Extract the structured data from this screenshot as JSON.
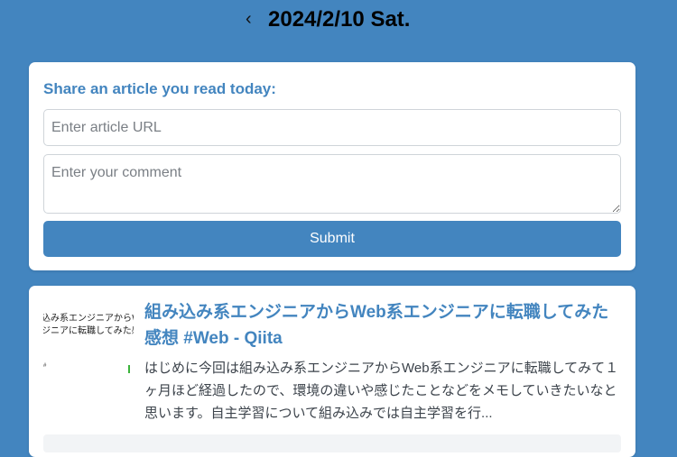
{
  "header": {
    "back_icon": "chevron-left-icon",
    "back_glyph": "‹",
    "date": "2024/2/10 Sat."
  },
  "form": {
    "title": "Share an article you read today:",
    "url_placeholder": "Enter article URL",
    "url_value": "",
    "comment_placeholder": "Enter your comment",
    "comment_value": "",
    "submit_label": "Submit"
  },
  "article": {
    "thumbnail_line1": "込み系エンジニアからWe",
    "thumbnail_line2": "ジニアに転職してみた感想",
    "thumbnail_small": "#",
    "title": "組み込み系エンジニアからWeb系エンジニアに転職してみた感想 #Web - Qiita",
    "description": "はじめに今回は組み込み系エンジニアからWeb系エンジニアに転職してみて１ヶ月ほど経過したので、環境の違いや感じたことなどをメモしていきたいなと思います。自主学習について組み込みでは自主学習を行..."
  },
  "colors": {
    "background": "#4385bf",
    "accent": "#4385bf",
    "card": "#ffffff"
  }
}
